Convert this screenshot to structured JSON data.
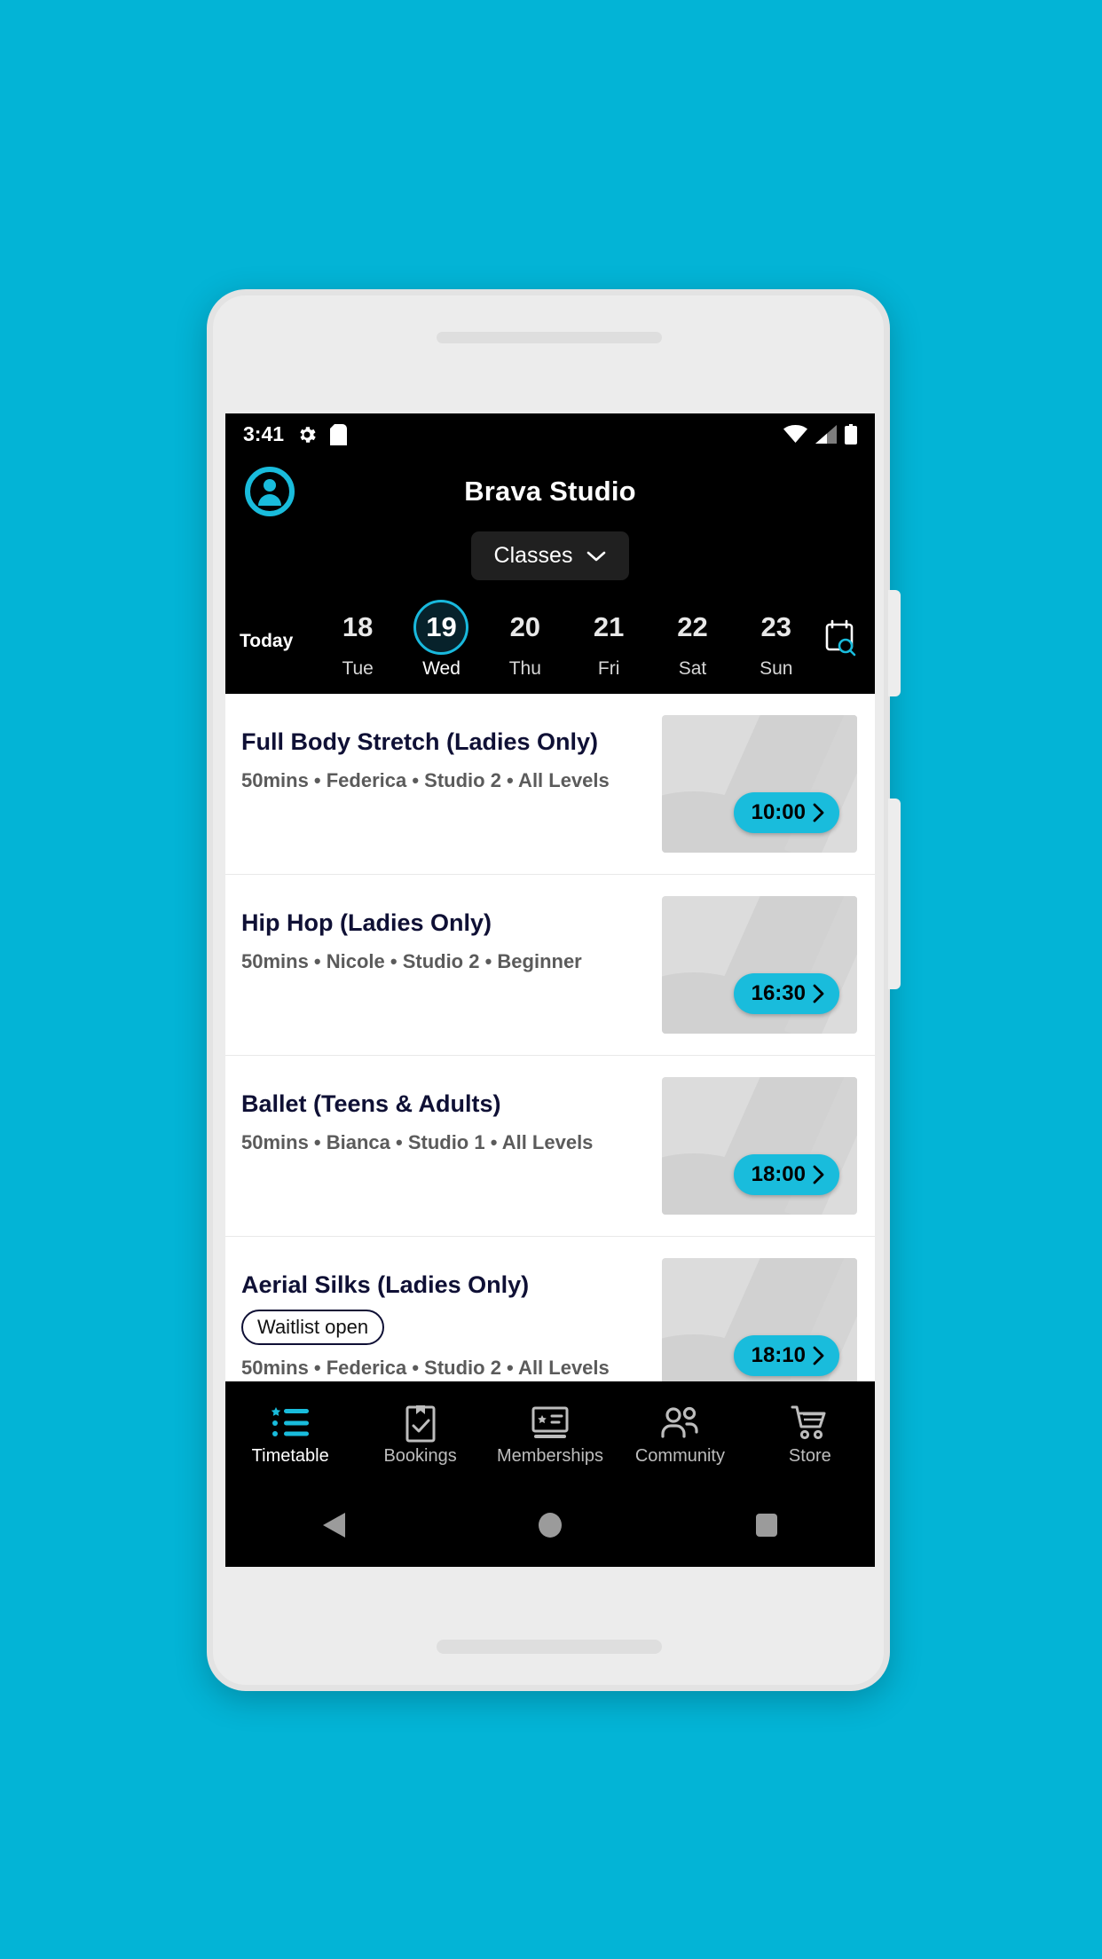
{
  "theme": {
    "background": "#03b4d6",
    "accent": "#19bcdc",
    "header_bg": "#000000",
    "title_color": "#0f1035"
  },
  "status_bar": {
    "time": "3:41",
    "left_icons": [
      "gear-icon",
      "sd-card-icon"
    ],
    "right_icons": [
      "wifi-icon",
      "cellular-signal-icon",
      "battery-icon"
    ]
  },
  "header": {
    "avatar_icon": "account-avatar-icon",
    "title": "Brava Studio",
    "dropdown_label": "Classes",
    "dropdown_icon": "chevron-down-icon"
  },
  "date_strip": {
    "today_label": "Today",
    "calendar_icon": "calendar-search-icon",
    "days": [
      {
        "num": "18",
        "dow": "Tue",
        "selected": false
      },
      {
        "num": "19",
        "dow": "Wed",
        "selected": true
      },
      {
        "num": "20",
        "dow": "Thu",
        "selected": false
      },
      {
        "num": "21",
        "dow": "Fri",
        "selected": false
      },
      {
        "num": "22",
        "dow": "Sat",
        "selected": false
      },
      {
        "num": "23",
        "dow": "Sun",
        "selected": false
      }
    ]
  },
  "classes": [
    {
      "title": "Full Body Stretch (Ladies Only)",
      "badge": "",
      "meta": "50mins • Federica • Studio 2 • All Levels",
      "time": "10:00"
    },
    {
      "title": "Hip Hop (Ladies Only)",
      "badge": "",
      "meta": "50mins • Nicole • Studio 2 • Beginner",
      "time": "16:30"
    },
    {
      "title": "Ballet (Teens & Adults)",
      "badge": "",
      "meta": "50mins • Bianca • Studio 1 • All Levels",
      "time": "18:00"
    },
    {
      "title": "Aerial Silks (Ladies Only)",
      "badge": "Waitlist open",
      "meta": "50mins • Federica • Studio 2 • All Levels",
      "time": "18:10"
    }
  ],
  "bottom_nav": [
    {
      "label": "Timetable",
      "icon": "list-star-icon",
      "active": true
    },
    {
      "label": "Bookings",
      "icon": "clipboard-check-icon",
      "active": false
    },
    {
      "label": "Memberships",
      "icon": "membership-card-icon",
      "active": false
    },
    {
      "label": "Community",
      "icon": "people-icon",
      "active": false
    },
    {
      "label": "Store",
      "icon": "shopping-cart-icon",
      "active": false
    }
  ],
  "android_nav": {
    "back": "back-triangle-icon",
    "home": "home-circle-icon",
    "recents": "recents-square-icon"
  }
}
